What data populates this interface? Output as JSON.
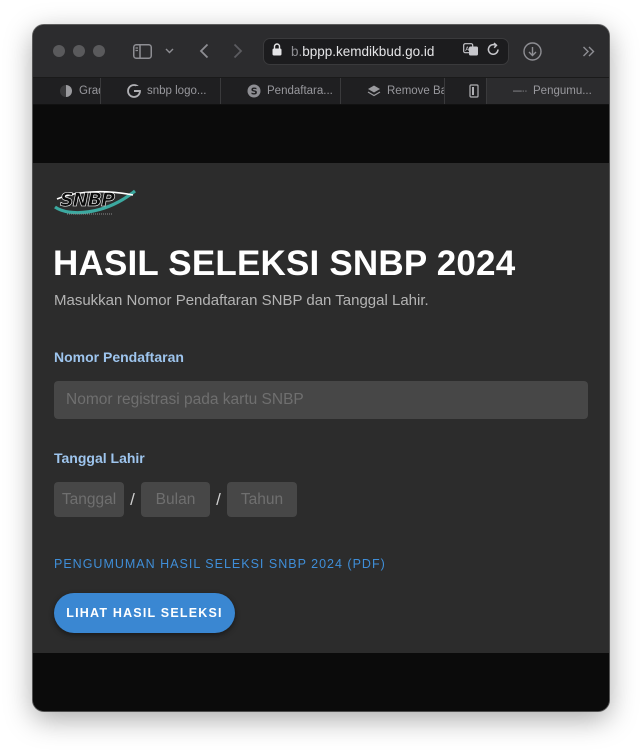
{
  "browser": {
    "url_prefix": "b.",
    "url_domain": "bppp.kemdikbud.go.id",
    "tabs": [
      {
        "label": "Grad",
        "icon": "half-circle-icon"
      },
      {
        "label": "snbp logo...",
        "icon": "google-icon"
      },
      {
        "label": "Pendaftara...",
        "icon": "s-circle-icon"
      },
      {
        "label": "Remove Ba",
        "icon": "layers-icon"
      },
      {
        "label": "",
        "icon": "bracket-icon"
      },
      {
        "label": "Pengumu...",
        "icon": "dash-icon"
      }
    ]
  },
  "page": {
    "logo_text": "SNBP",
    "title": "HASIL SELEKSI SNBP 2024",
    "subtitle": "Masukkan Nomor Pendaftaran SNBP dan Tanggal Lahir.",
    "reg_label": "Nomor Pendaftaran",
    "reg_placeholder": "Nomor registrasi pada kartu SNBP",
    "dob_label": "Tanggal Lahir",
    "day_placeholder": "Tanggal",
    "month_placeholder": "Bulan",
    "year_placeholder": "Tahun",
    "separator": "/",
    "pdf_link": "PENGUMUMAN HASIL SELEKSI SNBP 2024 (PDF)",
    "submit_label": "LIHAT HASIL SELEKSI"
  },
  "colors": {
    "accent": "#3a87d2",
    "label": "#9ec5ee",
    "card_bg": "#2c2c2c",
    "input_bg": "#474747",
    "logo_teal": "#3ca9a0"
  }
}
